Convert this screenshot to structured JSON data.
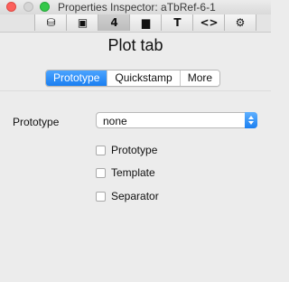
{
  "window": {
    "title": "Properties Inspector: aTbRef-6-1"
  },
  "toolbar": {
    "buttons": [
      {
        "icon": "stamp-icon",
        "glyph": "⛁"
      },
      {
        "icon": "note-icon",
        "glyph": "▣"
      },
      {
        "icon": "number-4-icon",
        "glyph": "4"
      },
      {
        "icon": "window-icon",
        "glyph": "▆"
      },
      {
        "icon": "text-t-icon",
        "glyph": "T"
      },
      {
        "icon": "code-brackets-icon",
        "glyph": "<>"
      },
      {
        "icon": "gear-icon",
        "glyph": "⚙"
      }
    ],
    "active_index": 2
  },
  "main": {
    "tab_title": "Plot tab",
    "segments": [
      "Prototype",
      "Quickstamp",
      "More"
    ],
    "selected_segment": 0,
    "prototype_label": "Prototype",
    "prototype_select_value": "none",
    "checkboxes": [
      {
        "label": "Prototype",
        "checked": false
      },
      {
        "label": "Template",
        "checked": false
      },
      {
        "label": "Separator",
        "checked": false
      }
    ]
  },
  "colors": {
    "accent": "#1a7ff1",
    "close": "#fc605c",
    "minimize": "#d5d5d5",
    "zoom": "#34c84a"
  }
}
